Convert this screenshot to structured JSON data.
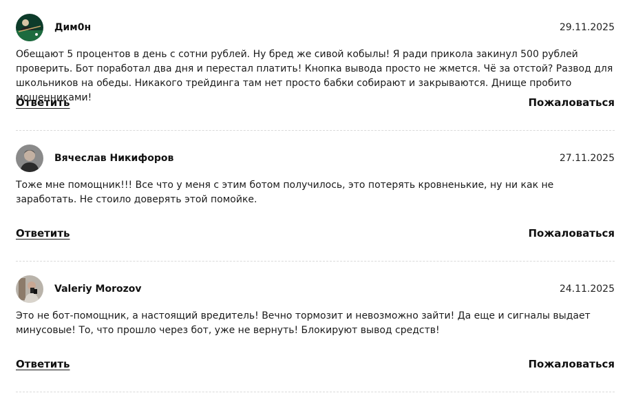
{
  "comments": [
    {
      "author": "Дим0н",
      "date": "29.11.2025",
      "text": "Обещают 5 процентов в день с сотни рублей. Ну бред же сивой кобылы! Я ради прикола закинул 500 рублей проверить. Бот поработал два дня и перестал платить! Кнопка вывода просто не жмется. Чё за отстой? Развод для школьников на обеды. Никакого трейдинга там нет просто бабки собирают и закрываются. Днище пробито мошенниками!",
      "reply_label": "Ответить",
      "report_label": "Пожаловаться",
      "avatar_icon": "avatar-billiards-icon"
    },
    {
      "author": "Вячеслав Никифоров",
      "date": "27.11.2025",
      "text": "Тоже мне помощник!!! Все что у меня с этим ботом получилось, это потерять кровненькие, ну ни как не заработать. Не стоило доверять этой помойке.",
      "reply_label": "Ответить",
      "report_label": "Пожаловаться",
      "avatar_icon": "avatar-man-photo-icon"
    },
    {
      "author": "Valeriy Morozov",
      "date": "24.11.2025",
      "text": "Это не бот-помощник, а настоящий вредитель! Вечно тормозит и невозможно зайти! Да еще и сигналы выдает минусовые! То, что прошло через бот, уже не вернуть! Блокируют вывод средств!",
      "reply_label": "Ответить",
      "report_label": "Пожаловаться",
      "avatar_icon": "avatar-mirror-selfie-icon"
    }
  ]
}
